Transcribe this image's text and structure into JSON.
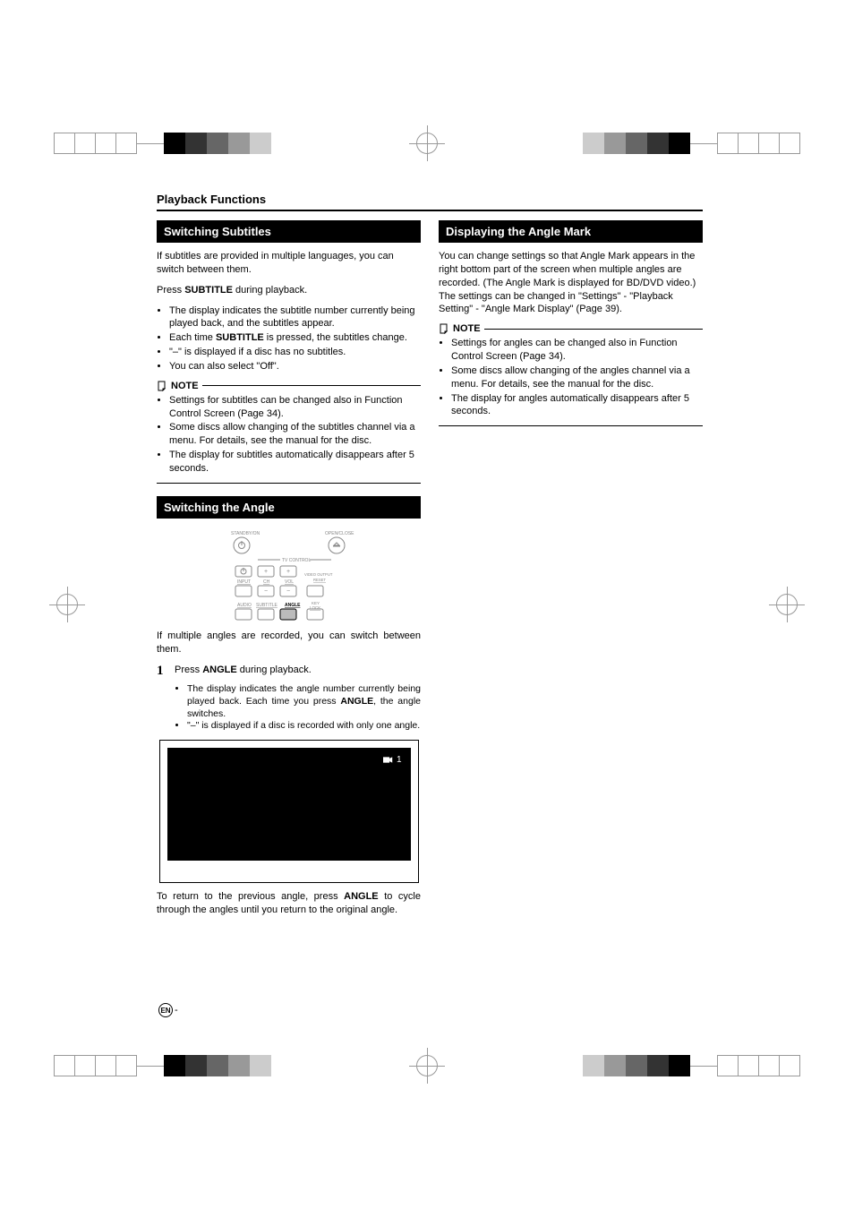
{
  "header": {
    "title": "Playback Functions"
  },
  "col1": {
    "sec1": {
      "heading": "Switching Subtitles",
      "intro": "If subtitles are provided in multiple languages, you can switch between them.",
      "instruction_pre": "Press ",
      "instruction_bold": "SUBTITLE",
      "instruction_post": " during playback.",
      "bullets": {
        "b1": "The display indicates the subtitle number currently being played back, and the subtitles appear.",
        "b2_pre": "Each time ",
        "b2_bold": "SUBTITLE",
        "b2_post": " is pressed, the subtitles change.",
        "b3": "\"–\" is displayed if a disc has no subtitles.",
        "b4": "You can also select \"Off\"."
      },
      "note_label": "NOTE",
      "notes": {
        "n1": "Settings for subtitles can be changed also in Function Control Screen (Page 34).",
        "n2": "Some discs allow changing of the subtitles channel via a menu. For details, see the manual for the disc.",
        "n3": "The display for subtitles automatically disappears after 5 seconds."
      }
    },
    "sec2": {
      "heading": "Switching the Angle",
      "intro": "If multiple angles are recorded, you can switch between them.",
      "step_num": "1",
      "step_pre": "Press ",
      "step_bold": "ANGLE",
      "step_post": " during playback.",
      "step_bullets": {
        "b1_pre": "The display indicates the angle number currently being played back. Each time you press ",
        "b1_bold": "ANGLE",
        "b1_post": ", the angle switches.",
        "b2": "\"–\" is displayed if a disc is recorded with only one angle."
      },
      "osd_value": "1",
      "closing_pre": "To return to the previous angle, press ",
      "closing_bold": "ANGLE",
      "closing_post": " to cycle through the angles until you return to the original angle."
    }
  },
  "col2": {
    "sec1": {
      "heading": "Displaying the Angle Mark",
      "intro": "You can change settings so that Angle Mark appears in the right bottom part of the screen when multiple angles are recorded. (The Angle Mark is displayed for BD/DVD video.) The settings can be changed in \"Settings\" - \"Playback Setting\" - \"Angle Mark Display\" (Page 39).",
      "note_label": "NOTE",
      "notes": {
        "n1": "Settings for angles can be changed also in Function Control Screen (Page 34).",
        "n2": "Some discs allow changing of the angles channel via a menu. For details, see the manual for the disc.",
        "n3": "The display for angles automatically disappears after 5 seconds."
      }
    }
  },
  "remote": {
    "standby": "STANDBY/ON",
    "open": "OPEN/CLOSE",
    "tvcontrol": "TV CONTROL",
    "input": "INPUT",
    "ch": "CH",
    "vol": "VOL",
    "video": "VIDEO OUTPUT RESET",
    "audio": "AUDIO",
    "subtitle": "SUBTITLE",
    "angle": "ANGLE",
    "lock": "KEY LOCK"
  },
  "footer": {
    "lang": "EN",
    "dash": " -"
  }
}
